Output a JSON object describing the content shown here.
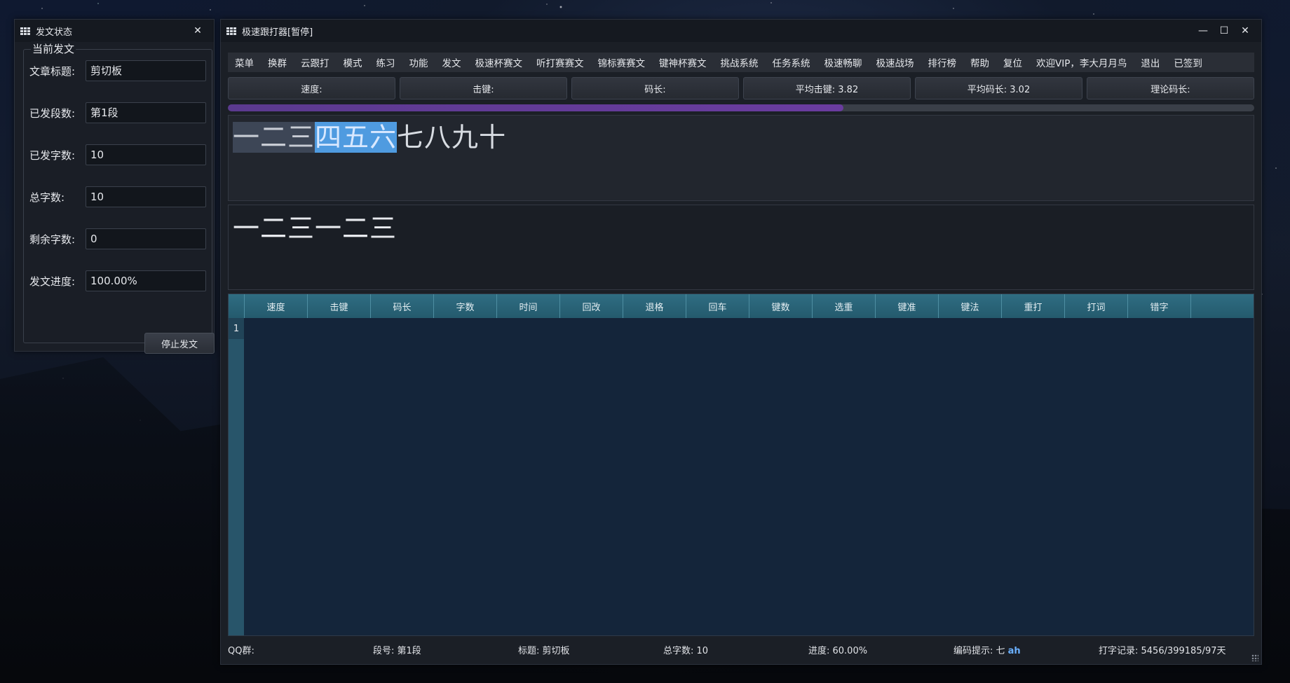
{
  "status_window": {
    "title": "发文状态",
    "close": "✕",
    "group_title": "当前发文",
    "fields": [
      {
        "label": "文章标题:",
        "value": "剪切板"
      },
      {
        "label": "已发段数:",
        "value": "第1段"
      },
      {
        "label": "已发字数:",
        "value": "10"
      },
      {
        "label": "总字数:",
        "value": "10"
      },
      {
        "label": "剩余字数:",
        "value": "0"
      },
      {
        "label": "发文进度:",
        "value": "100.00%"
      }
    ],
    "stop_button": "停止发文"
  },
  "main_window": {
    "title": "极速跟打器[暂停]",
    "controls": {
      "minimize": "—",
      "maximize": "☐",
      "close": "✕"
    },
    "menu": [
      "菜单",
      "换群",
      "云跟打",
      "模式",
      "练习",
      "功能",
      "发文",
      "极速杯赛文",
      "听打赛赛文",
      "锦标赛赛文",
      "键神杯赛文",
      "挑战系统",
      "任务系统",
      "极速畅聊",
      "极速战场",
      "排行榜",
      "帮助",
      "复位",
      "欢迎VIP，李大月月鸟",
      "退出",
      "已签到"
    ],
    "stats": [
      "速度:",
      "击键:",
      "码长:",
      "平均击键: 3.82",
      "平均码长: 3.02",
      "理论码长:"
    ],
    "progress_percent": 60,
    "reference_text": {
      "done": "一二三",
      "current": "四五六",
      "rest": "七八九十"
    },
    "typed_text": "一二三一二三",
    "table": {
      "columns": [
        "速度",
        "击键",
        "码长",
        "字数",
        "时间",
        "回改",
        "退格",
        "回车",
        "键数",
        "选重",
        "键准",
        "键法",
        "重打",
        "打词",
        "错字"
      ],
      "row_numbers": [
        "1"
      ]
    },
    "statusbar": {
      "qq": "QQ群:",
      "segment": "段号: 第1段",
      "title": "标题: 剪切板",
      "total": "总字数: 10",
      "progress": "进度: 60.00%",
      "hint_label": "编码提示: 七",
      "hint_code": "ah",
      "record": "打字记录: 5456/399185/97天"
    }
  },
  "colors": {
    "accent_progress": "#6a3c9f",
    "highlight": "#4f9be0",
    "table_header": "#2f6d82",
    "hint_code": "#6ab0ff"
  }
}
